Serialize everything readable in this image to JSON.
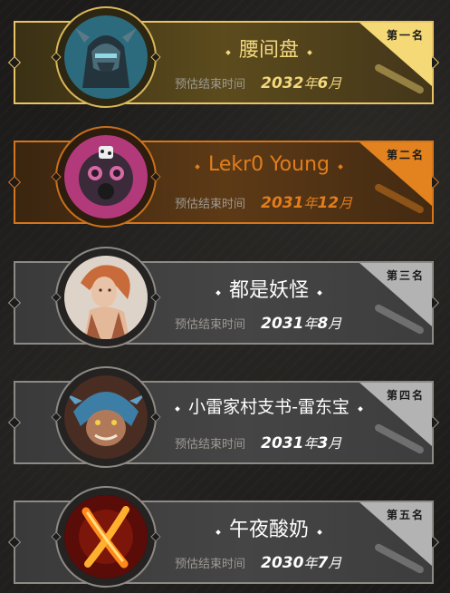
{
  "ranks": [
    {
      "rank_label": "第一名",
      "name": "腰间盘",
      "end_label": "预估结束时间",
      "year": "2032",
      "year_unit": "年",
      "month": "6",
      "month_unit": "月",
      "avatar_icon": "armored-hero-icon"
    },
    {
      "rank_label": "第二名",
      "name": "Lekr0 Young",
      "end_label": "预估结束时间",
      "year": "2031",
      "year_unit": "年",
      "month": "12",
      "month_unit": "月",
      "avatar_icon": "gas-mask-icon"
    },
    {
      "rank_label": "第三名",
      "name": "都是妖怪",
      "end_label": "预估结束时间",
      "year": "2031",
      "year_unit": "年",
      "month": "8",
      "month_unit": "月",
      "avatar_icon": "fantasy-woman-icon"
    },
    {
      "rank_label": "第四名",
      "name": "小雷家村支书-雷东宝",
      "end_label": "预估结束时间",
      "year": "2031",
      "year_unit": "年",
      "month": "3",
      "month_unit": "月",
      "avatar_icon": "hooded-goblin-icon"
    },
    {
      "rank_label": "第五名",
      "name": "午夜酸奶",
      "end_label": "预估结束时间",
      "year": "2030",
      "year_unit": "年",
      "month": "7",
      "month_unit": "月",
      "avatar_icon": "fire-x-icon"
    }
  ],
  "colors": {
    "gold": "#f2d77d",
    "orange": "#e27d1d",
    "silver": "#b3b3b3"
  }
}
